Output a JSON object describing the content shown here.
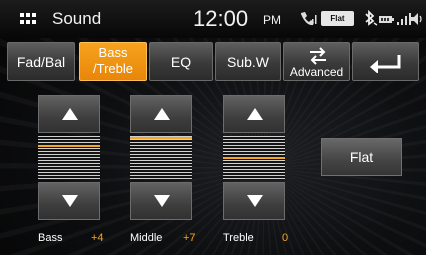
{
  "header": {
    "title": "Sound",
    "time": "12:00",
    "ampm": "PM",
    "eq_chip": "Flat"
  },
  "status_icons": [
    "phone-signal-icon",
    "bluetooth-icon",
    "battery-icon",
    "signal-bars-icon",
    "volume-icon"
  ],
  "tabs": [
    {
      "label": "Fad/Bal",
      "active": false
    },
    {
      "label": "Bass /Treble",
      "line1": "Bass",
      "line2": "/Treble",
      "active": true
    },
    {
      "label": "EQ",
      "active": false
    },
    {
      "label": "Sub.W",
      "active": false
    },
    {
      "label": "Advanced",
      "icon": "swap-arrows-icon",
      "active": false
    }
  ],
  "back_button": {
    "icon": "back-arrow-icon"
  },
  "bands": [
    {
      "name": "Bass",
      "value": "+4"
    },
    {
      "name": "Middle",
      "value": "+7"
    },
    {
      "name": "Treble",
      "value": "0"
    }
  ],
  "flat_button": {
    "label": "Flat"
  },
  "colors": {
    "accent": "#f5a623",
    "tab_active": "#f29412",
    "background": "#0a0a0a"
  }
}
